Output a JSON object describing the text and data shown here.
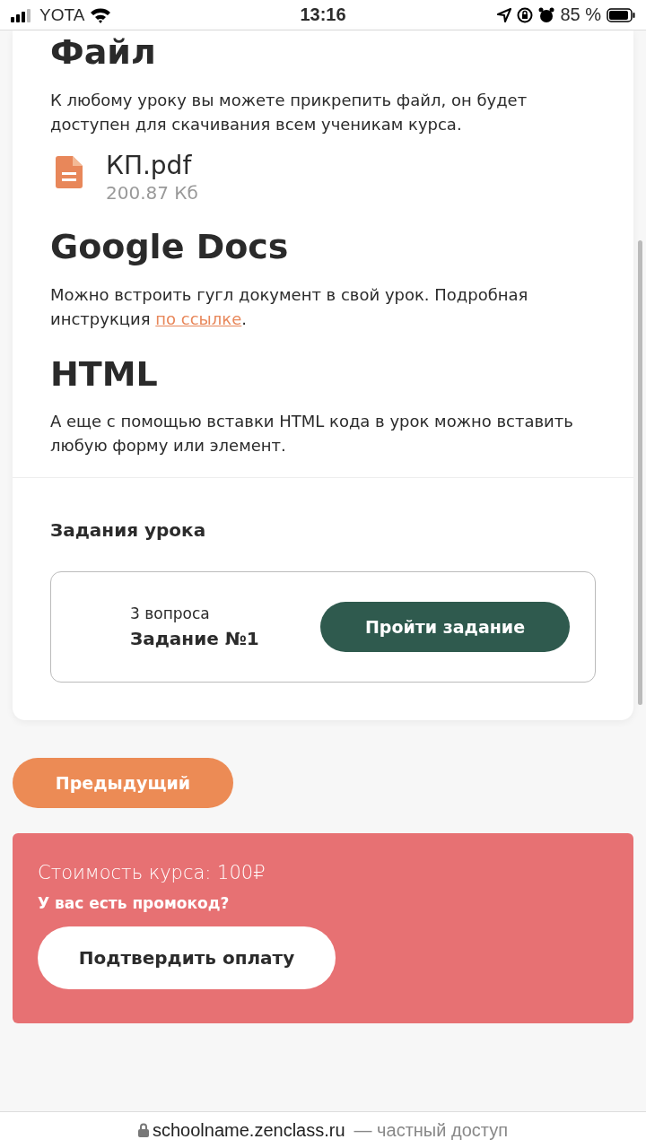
{
  "status_bar": {
    "carrier": "YOTA",
    "time": "13:16",
    "battery": "85 %"
  },
  "lesson": {
    "sections": [
      {
        "kind": "file",
        "title": "Файл",
        "text": "К любому уроку вы можете прикрепить файл, он будет доступен для скачивания всем ученикам курса.",
        "file": {
          "name": "КП.pdf",
          "size": "200.87 Кб"
        }
      },
      {
        "kind": "link",
        "title": "Google Docs",
        "text": "Можно встроить гугл документ в свой урок. Подробная инструкция ",
        "link": "по ссылке",
        "after": "."
      },
      {
        "kind": "text",
        "title": "HTML",
        "text": "А еще с помощью вставки HTML кода в урок можно вставить любую форму или элемент."
      }
    ],
    "tasks_title": "Задания урока",
    "tasks": [
      {
        "count": "3 вопроса",
        "name": "Задание №1",
        "button": "Пройти задание"
      }
    ]
  },
  "prev_button": "Предыдущий",
  "payment": {
    "price": "Стоимость курса: 100₽",
    "promo": "У вас есть промокод?",
    "button": "Подтвердить оплату"
  },
  "address_bar": {
    "domain": "schoolname.zenclass.ru",
    "note": "— частный доступ"
  }
}
